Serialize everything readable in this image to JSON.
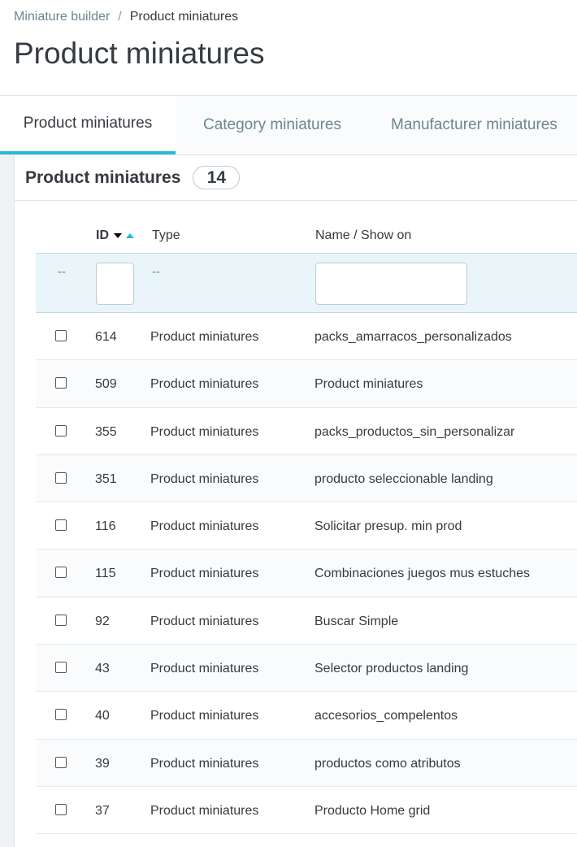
{
  "breadcrumb": {
    "parent": "Miniature builder",
    "current": "Product miniatures"
  },
  "page_title": "Product miniatures",
  "tabs": [
    {
      "label": "Product miniatures",
      "active": true
    },
    {
      "label": "Category miniatures",
      "active": false
    },
    {
      "label": "Manufacturer miniatures",
      "active": false
    }
  ],
  "card": {
    "title": "Product miniatures",
    "count": "14"
  },
  "table": {
    "columns": {
      "id": "ID",
      "type": "Type",
      "name": "Name / Show on"
    },
    "filters": {
      "select_placeholder": "--",
      "type_placeholder": "--",
      "id_value": "",
      "name_value": ""
    },
    "rows": [
      {
        "id": "614",
        "type": "Product miniatures",
        "name": "packs_amarracos_personalizados"
      },
      {
        "id": "509",
        "type": "Product miniatures",
        "name": "Product miniatures"
      },
      {
        "id": "355",
        "type": "Product miniatures",
        "name": "packs_productos_sin_personalizar"
      },
      {
        "id": "351",
        "type": "Product miniatures",
        "name": "producto seleccionable landing"
      },
      {
        "id": "116",
        "type": "Product miniatures",
        "name": "Solicitar presup. min prod"
      },
      {
        "id": "115",
        "type": "Product miniatures",
        "name": "Combinaciones juegos mus estuches"
      },
      {
        "id": "92",
        "type": "Product miniatures",
        "name": "Buscar Simple"
      },
      {
        "id": "43",
        "type": "Product miniatures",
        "name": "Selector productos landing"
      },
      {
        "id": "40",
        "type": "Product miniatures",
        "name": "accesorios_compelentos"
      },
      {
        "id": "39",
        "type": "Product miniatures",
        "name": "productos como atributos"
      },
      {
        "id": "37",
        "type": "Product miniatures",
        "name": "Producto Home grid"
      }
    ]
  },
  "colors": {
    "accent": "#25b9d7",
    "text": "#363a41",
    "muted": "#6c868e",
    "filter_bg": "#eaf5fa"
  }
}
